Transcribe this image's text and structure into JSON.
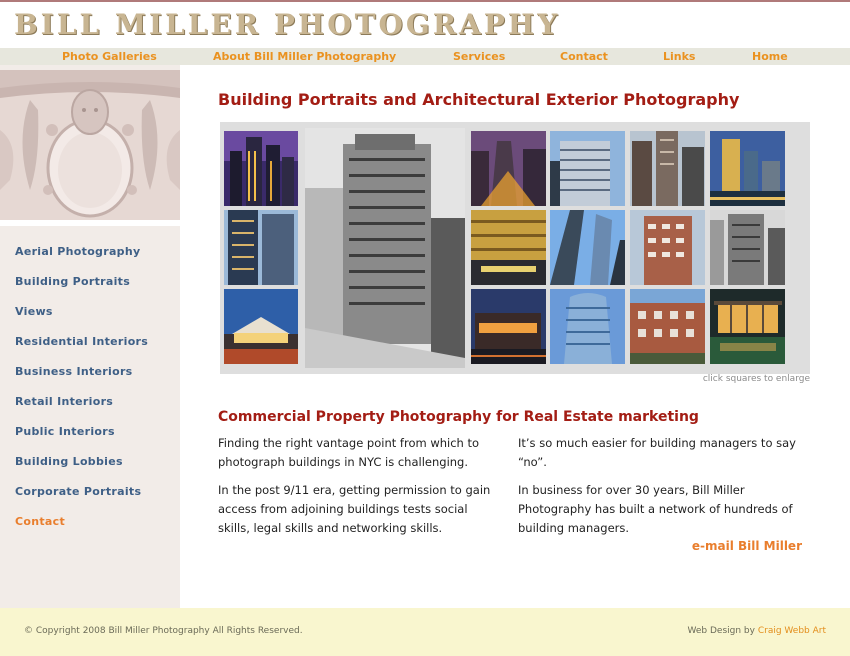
{
  "header": {
    "title": "BILL MILLER PHOTOGRAPHY"
  },
  "nav": [
    {
      "label": "Photo Galleries"
    },
    {
      "label": "About Bill Miller Photography"
    },
    {
      "label": "Services"
    },
    {
      "label": "Contact"
    },
    {
      "label": "Links"
    },
    {
      "label": "Home"
    }
  ],
  "sidebar": {
    "links": [
      {
        "label": "Aerial Photography"
      },
      {
        "label": "Building Portraits"
      },
      {
        "label": "Views"
      },
      {
        "label": "Residential Interiors"
      },
      {
        "label": "Business Interiors"
      },
      {
        "label": "Retail Interiors"
      },
      {
        "label": "Public Interiors"
      },
      {
        "label": "Building Lobbies"
      },
      {
        "label": "Corporate Portraits"
      },
      {
        "label": "Contact"
      }
    ]
  },
  "main": {
    "title": "Building Portraits and Architectural Exterior Photography",
    "gallery_note": "click squares to enlarge",
    "subtitle": "Commercial Property Photography for Real Estate marketing",
    "left_paragraphs": [
      "Finding the right vantage point from which to photograph buildings in NYC is challenging.",
      "In the post 9/11 era, getting permission to gain access from adjoining buildings tests social skills, legal skills and networking skills."
    ],
    "right_paragraphs": [
      "It’s so much easier for building managers to say “no”.",
      "In business for over 30 years, Bill Miller Photography has built a network of hundreds of building managers."
    ],
    "email_label": "e-mail Bill Miller"
  },
  "footer": {
    "copyright": "© Copyright 2008 Bill Miller Photography  All Rights Reserved.",
    "credit_prefix": "Web Design by ",
    "credit_link": "Craig Webb Art"
  },
  "colors": {
    "accent_orange": "#ea9220",
    "title_red": "#a31d14",
    "sidebar_link": "#3e5f86",
    "footer_bg": "#f9f6cf"
  }
}
